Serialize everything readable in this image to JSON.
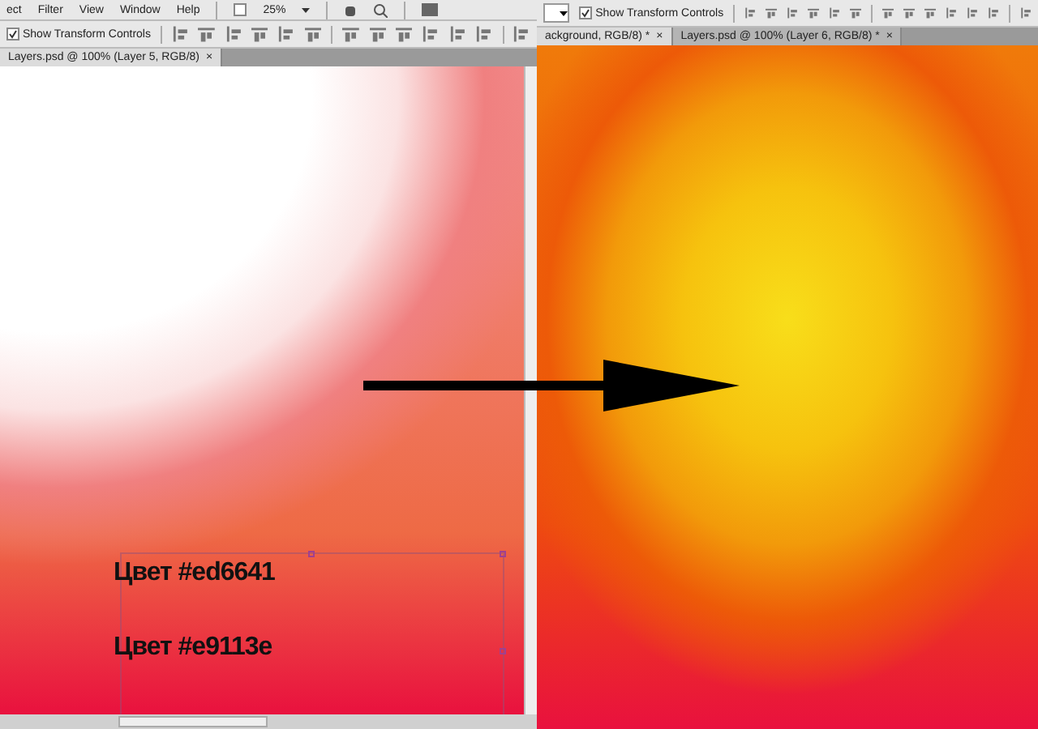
{
  "windows": [
    {
      "menu": [
        "ect",
        "Filter",
        "View",
        "Window",
        "Help"
      ],
      "zoom": "25%",
      "transform": {
        "label": "Show Transform Controls",
        "checked": true
      },
      "tabs": [
        {
          "label": "Layers.psd @ 100% (Layer 5, RGB/8)",
          "close": "×",
          "selected": true
        }
      ],
      "canvas": {
        "kind": "white-red"
      },
      "captions": [
        "Цвет #ed6641",
        "Цвет #e9113e"
      ]
    },
    {
      "transform": {
        "label": "Show Transform Controls",
        "checked": true
      },
      "tabs": [
        {
          "label": "ackground, RGB/8) *",
          "close": "×",
          "selected": true
        },
        {
          "label": "Layers.psd @ 100% (Layer 6, RGB/8) *",
          "close": "×",
          "selected": false
        }
      ],
      "canvas": {
        "kind": "orange-yellow"
      }
    }
  ]
}
